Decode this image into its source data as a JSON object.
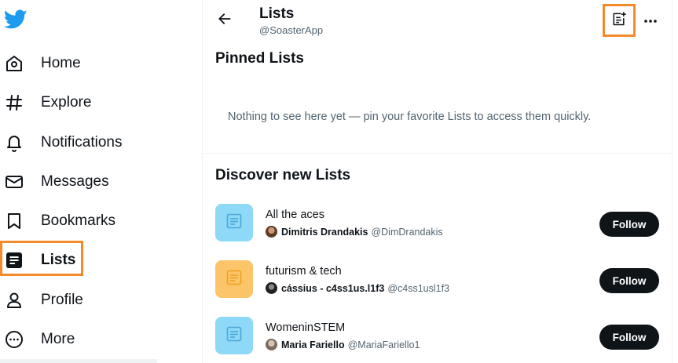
{
  "colors": {
    "brand": "#1d9bf0",
    "highlight": "#f58a2a",
    "text_primary": "#0f1419",
    "text_secondary": "#536471",
    "button_dark": "#0f1419",
    "thumb_blue": "#8ed8f8",
    "thumb_orange": "#fcc56a"
  },
  "sidebar": {
    "logo_icon": "twitter-bird-icon",
    "items": [
      {
        "label": "Home",
        "icon": "home-icon"
      },
      {
        "label": "Explore",
        "icon": "hashtag-icon"
      },
      {
        "label": "Notifications",
        "icon": "bell-icon"
      },
      {
        "label": "Messages",
        "icon": "envelope-icon"
      },
      {
        "label": "Bookmarks",
        "icon": "bookmark-icon"
      },
      {
        "label": "Lists",
        "icon": "lists-icon",
        "active": true
      },
      {
        "label": "Profile",
        "icon": "person-icon"
      },
      {
        "label": "More",
        "icon": "more-circle-icon"
      }
    ]
  },
  "header": {
    "title": "Lists",
    "handle": "@SoasterApp",
    "back_icon": "arrow-left-icon",
    "new_list_icon": "new-list-icon",
    "more_icon": "ellipsis-icon"
  },
  "pinned": {
    "title": "Pinned Lists",
    "empty_text": "Nothing to see here yet — pin your favorite Lists to access them quickly."
  },
  "discover": {
    "title": "Discover new Lists",
    "lists": [
      {
        "name": "All the aces",
        "owner_name": "Dimitris Drandakis",
        "owner_handle": "@DimDrandakis",
        "follow_label": "Follow",
        "thumb_color": "blue"
      },
      {
        "name": "futurism & tech",
        "owner_name": "cássius - c4ss1us.l1f3",
        "owner_handle": "@c4ss1usl1f3",
        "follow_label": "Follow",
        "thumb_color": "orange"
      },
      {
        "name": "WomeninSTEM",
        "owner_name": "Maria Fariello",
        "owner_handle": "@MariaFariello1",
        "follow_label": "Follow",
        "thumb_color": "blue"
      }
    ]
  }
}
